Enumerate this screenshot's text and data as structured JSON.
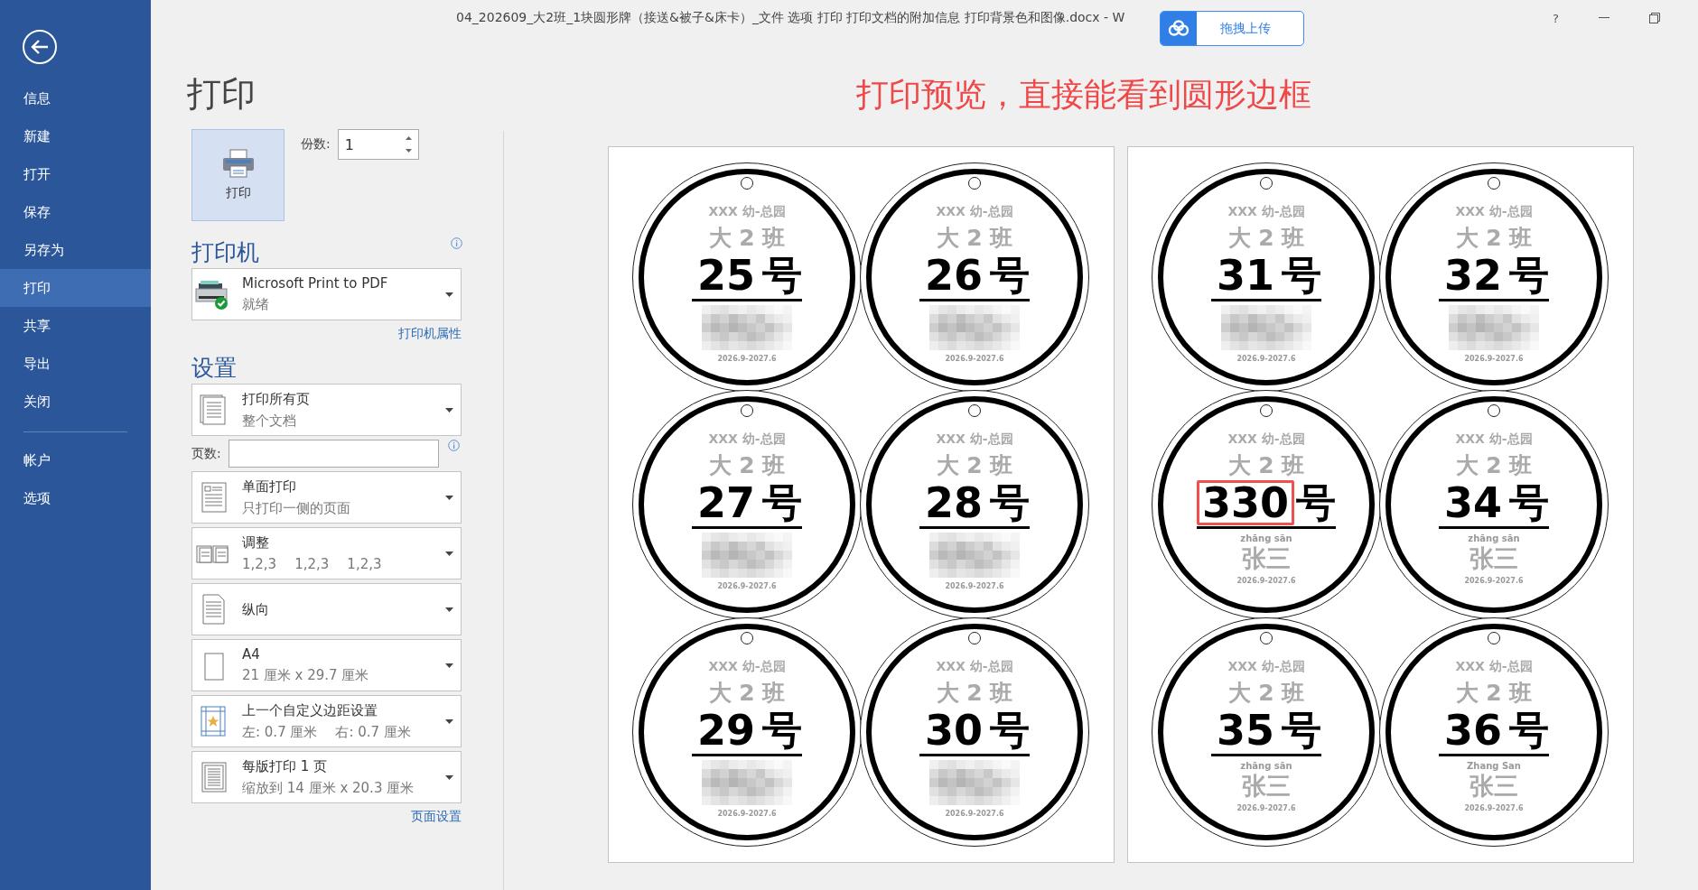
{
  "window": {
    "title": "04_202609_大2班_1块圆形牌（接送&被子&床卡）_文件 选项 打印 打印文档的附加信息 打印背景色和图像.docx - W",
    "help": "?"
  },
  "upload_button": {
    "label": "拖拽上传"
  },
  "sidebar": {
    "items": [
      {
        "label": "信息",
        "selected": false
      },
      {
        "label": "新建",
        "selected": false
      },
      {
        "label": "打开",
        "selected": false
      },
      {
        "label": "保存",
        "selected": false
      },
      {
        "label": "另存为",
        "selected": false
      },
      {
        "label": "打印",
        "selected": true
      },
      {
        "label": "共享",
        "selected": false
      },
      {
        "label": "导出",
        "selected": false
      },
      {
        "label": "关闭",
        "selected": false
      }
    ],
    "footer_items": [
      {
        "label": "帐户",
        "selected": false
      },
      {
        "label": "选项",
        "selected": false
      }
    ]
  },
  "print": {
    "title": "打印",
    "print_button": "打印",
    "copies": {
      "label": "份数:",
      "value": "1"
    }
  },
  "printer": {
    "heading": "打印机",
    "name": "Microsoft Print to PDF",
    "status": "就绪",
    "properties_link": "打印机属性"
  },
  "settings": {
    "heading": "设置",
    "options": [
      {
        "main": "打印所有页",
        "sub": [
          "整个文档"
        ]
      },
      {
        "main": "单面打印",
        "sub": [
          "只打印一侧的页面"
        ]
      },
      {
        "main": "调整",
        "sub": [
          "1,2,3",
          "1,2,3",
          "1,2,3"
        ]
      },
      {
        "main": "纵向"
      },
      {
        "main": "A4",
        "sub": [
          "21 厘米 x 29.7 厘米"
        ]
      },
      {
        "main": "上一个自定义边距设置",
        "sub": [
          "左: 0.7 厘米",
          "右: 0.7 厘米"
        ]
      },
      {
        "main": "每版打印 1 页",
        "sub": [
          "缩放到 14 厘米 x 20.3 厘米"
        ]
      }
    ],
    "pages_field": {
      "label": "页数:"
    },
    "page_setup_link": "页面设置"
  },
  "annotation": "打印预览，直接能看到圆形边框",
  "preview": {
    "pages": [
      {
        "tags": [
          {
            "school": "XXX 幼-总园",
            "class": "大 2 班",
            "number": "25",
            "suffix": "号",
            "redacted": true,
            "highlighted": false,
            "date": "2026.9-2027.6"
          },
          {
            "school": "XXX 幼-总园",
            "class": "大 2 班",
            "number": "26",
            "suffix": "号",
            "redacted": true,
            "highlighted": false,
            "date": "2026.9-2027.6"
          },
          {
            "school": "XXX 幼-总园",
            "class": "大 2 班",
            "number": "27",
            "suffix": "号",
            "redacted": true,
            "highlighted": false,
            "date": "2026.9-2027.6"
          },
          {
            "school": "XXX 幼-总园",
            "class": "大 2 班",
            "number": "28",
            "suffix": "号",
            "redacted": true,
            "highlighted": false,
            "date": "2026.9-2027.6"
          },
          {
            "school": "XXX 幼-总园",
            "class": "大 2 班",
            "number": "29",
            "suffix": "号",
            "redacted": true,
            "highlighted": false,
            "date": "2026.9-2027.6"
          },
          {
            "school": "XXX 幼-总园",
            "class": "大 2 班",
            "number": "30",
            "suffix": "号",
            "redacted": true,
            "highlighted": false,
            "date": "2026.9-2027.6"
          }
        ]
      },
      {
        "tags": [
          {
            "school": "XXX 幼-总园",
            "class": "大 2 班",
            "number": "31",
            "suffix": "号",
            "redacted": true,
            "highlighted": false,
            "date": "2026.9-2027.6"
          },
          {
            "school": "XXX 幼-总园",
            "class": "大 2 班",
            "number": "32",
            "suffix": "号",
            "redacted": true,
            "highlighted": false,
            "date": "2026.9-2027.6"
          },
          {
            "school": "XXX 幼-总园",
            "class": "大 2 班",
            "number": "330",
            "suffix": "号",
            "redacted": false,
            "highlighted": true,
            "pinyin": "zhāng sān",
            "name": "张三",
            "date": "2026.9-2027.6"
          },
          {
            "school": "XXX 幼-总园",
            "class": "大 2 班",
            "number": "34",
            "suffix": "号",
            "redacted": false,
            "highlighted": false,
            "pinyin": "zhāng sān",
            "name": "张三",
            "date": "2026.9-2027.6"
          },
          {
            "school": "XXX 幼-总园",
            "class": "大 2 班",
            "number": "35",
            "suffix": "号",
            "redacted": false,
            "highlighted": false,
            "pinyin": "zhāng sān",
            "name": "张三",
            "date": "2026.9-2027.6"
          },
          {
            "school": "XXX 幼-总园",
            "class": "大 2 班",
            "number": "36",
            "suffix": "号",
            "redacted": false,
            "highlighted": false,
            "pinyin": "Zhang San",
            "name": "张三",
            "date": "2026.9-2027.6"
          }
        ]
      }
    ]
  }
}
